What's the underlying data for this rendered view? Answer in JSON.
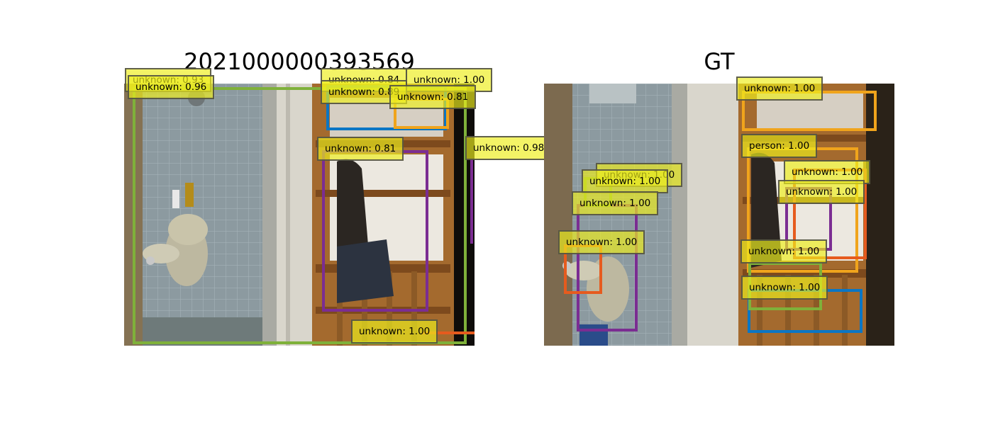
{
  "titles": {
    "left": "2021000000393569",
    "right": "GT"
  },
  "colors": {
    "green": "#7fb13a",
    "blue": "#0b76c4",
    "orange": "#f0a41c",
    "purple": "#7b2d92",
    "red_orange": "#e65b1e",
    "label_fill": "#eeee1e"
  },
  "left_panel": {
    "labels": [
      "unknown: 0.93",
      "unknown: 0.96",
      "unknown: 0.84",
      "unknown: 0.89",
      "unknown: 1.00",
      "unknown: 0.81",
      "unknown: 0.81",
      "unknown: 0.98",
      "unknown: 1.00"
    ]
  },
  "right_panel": {
    "labels": [
      "unknown: 1.00",
      "person: 1.00",
      "unknown: 1.00",
      "unknown: 1.00",
      "unknown: 1.00",
      "unknown: 1.00",
      "unknown: 1.00",
      "unknown: 1.00",
      "unknown: 1.00",
      "unknown: 1.00"
    ]
  }
}
